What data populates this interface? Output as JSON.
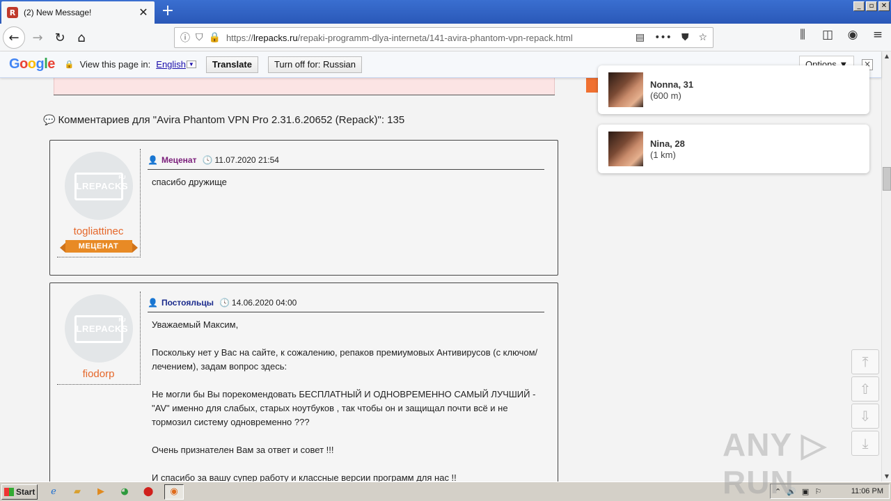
{
  "browser": {
    "tab_title": "(2) New Message!",
    "tab_favicon": "R",
    "url_prefix": "https://",
    "url_host": "lrepacks.ru",
    "url_path": "/repaki-programm-dlya-interneta/141-avira-phantom-vpn-repack.html"
  },
  "translate_bar": {
    "prompt": "View this page in:",
    "language": "English",
    "translate_label": "Translate",
    "turn_off_label": "Turn off for: Russian",
    "options_label": "Options ▼",
    "close_label": "×"
  },
  "comments": {
    "heading": "Комментариев для \"Avira Phantom VPN Pro 2.31.6.20652 (Repack)\": 135",
    "items": [
      {
        "username": "togliattinec",
        "badge": "МЕЦЕНАТ",
        "group": "Меценат",
        "date": "11.07.2020 21:54",
        "paragraphs": [
          "спасибо дружище"
        ]
      },
      {
        "username": "fiodorp",
        "group": "Постояльцы",
        "date": "14.06.2020 04:00",
        "paragraphs": [
          "Уважаемый Максим,",
          "Поскольку нет у Вас на сайте, к сожалению, репаков премиумовых Антивирусов (с ключом/лечением), задам вопрос здесь:",
          "Не могли бы Вы порекомендовать БЕСПЛАТНЫЙ И ОДНОВРЕМЕННО САМЫЙ ЛУЧШИЙ - \"AV\" именно для слабых, старых ноутбуков , так чтобы он и защищал почти всё и не тормозил систему одновременно ???",
          "Очень признателен Вам за ответ и совет !!!",
          "И спасибо за вашу супер работу и классные версии программ для нас !!"
        ]
      }
    ],
    "avatar_logo": "LREPACKS",
    "avatar_ru": "RU"
  },
  "notifications": [
    {
      "name": "Nonna, 31",
      "distance": "(600 m)"
    },
    {
      "name": "Nina, 28",
      "distance": "(1 km)"
    }
  ],
  "watermark": "ANY ▷ RUN",
  "taskbar": {
    "start_label": "Start",
    "clock": "11:06 PM"
  },
  "colors": {
    "mecenat_group": "#7a1d7a",
    "post_group": "#1a2a8c",
    "username": "#e5672a",
    "badge": "#e88a25"
  }
}
